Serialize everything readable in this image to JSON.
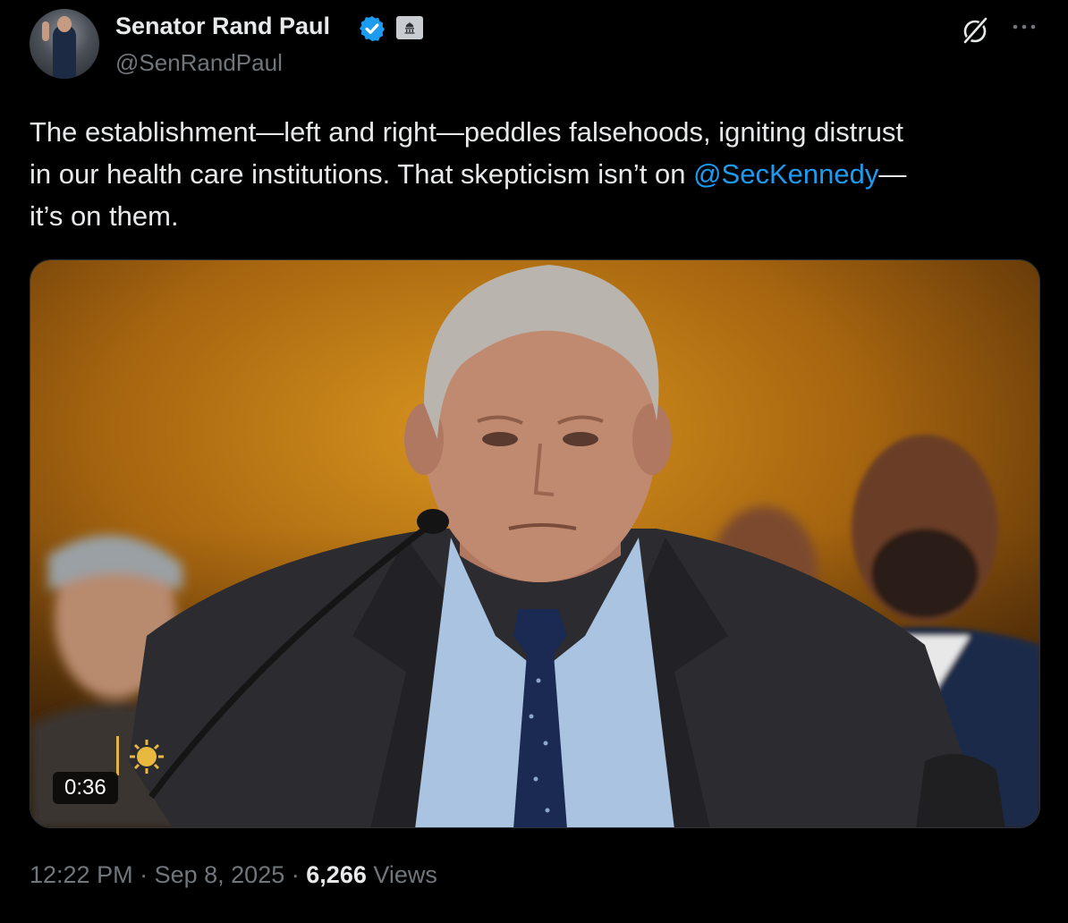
{
  "author": {
    "display_name": "Senator Rand Paul",
    "handle": "@SenRandPaul",
    "verified": true,
    "affiliation": "government-building-icon"
  },
  "tweet": {
    "text_line1": "The establishment—left and right—peddles falsehoods, igniting distrust",
    "text_line2_prefix": "in our health care institutions. That skepticism isn’t on ",
    "mention": "@SecKennedy",
    "text_line2_suffix": "—",
    "text_line3": "it’s on them."
  },
  "media": {
    "type": "video",
    "duration": "0:36"
  },
  "meta": {
    "time": "12:22 PM",
    "separator": "·",
    "date": "Sep 8, 2025",
    "views_count": "6,266",
    "views_label": "Views"
  },
  "icons": {
    "grok": "grok-icon",
    "more": "more-icon"
  },
  "colors": {
    "background": "#000000",
    "text": "#e7e9ea",
    "secondary": "#71767b",
    "link": "#1d9bf0",
    "verified": "#1d9bf0"
  }
}
